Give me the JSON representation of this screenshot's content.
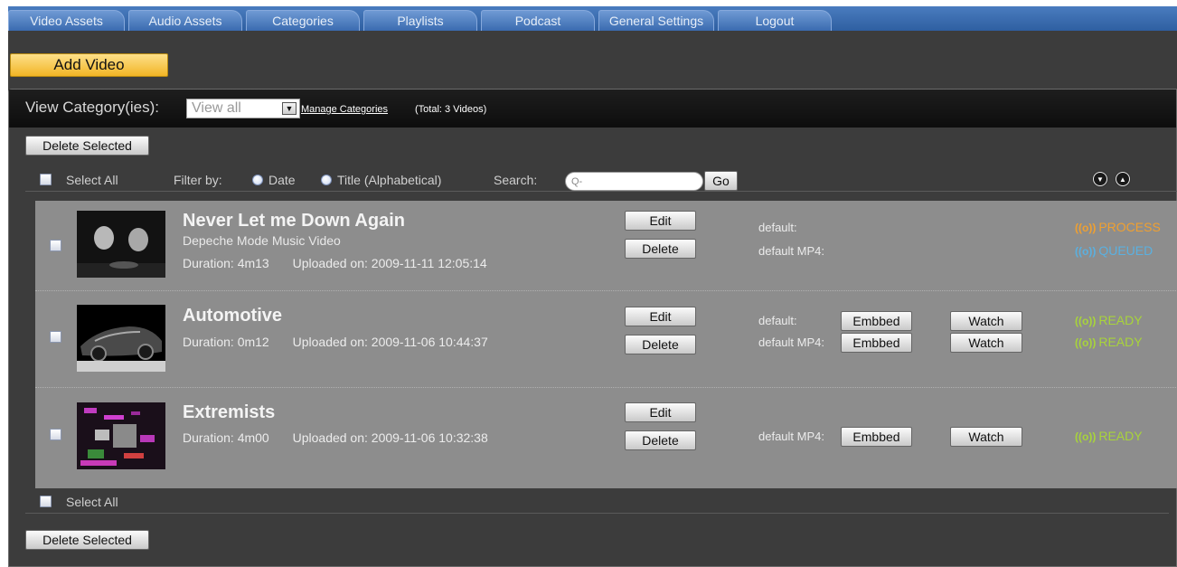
{
  "tabs": [
    "Video Assets",
    "Audio Assets",
    "Categories",
    "Playlists",
    "Podcast",
    "General Settings",
    "Logout"
  ],
  "add_video_label": "Add Video",
  "panel": {
    "view_category_label": "View Category(ies):",
    "category_select_value": "View all",
    "manage_categories_link": "Manage Categories",
    "total_text": "(Total: 3 Videos)",
    "delete_selected_label": "Delete Selected",
    "select_all_label": "Select All",
    "filter_by_label": "Filter by:",
    "filter_date_label": "Date",
    "filter_title_label": "Title (Alphabetical)",
    "search_label": "Search:",
    "search_placeholder": "Q-",
    "go_label": "Go"
  },
  "videos": [
    {
      "title": "Never Let me Down Again",
      "subtitle": "Depeche Mode Music Video",
      "duration": "Duration: 4m13",
      "uploaded": "Uploaded on: 2009-11-11 12:05:14",
      "edit_label": "Edit",
      "delete_label": "Delete",
      "formats": [
        {
          "name": "default:",
          "status": "PROCESS",
          "status_color": "#f0a030"
        },
        {
          "name": "default MP4:",
          "status": "QUEUED",
          "status_color": "#5ab0e0"
        }
      ]
    },
    {
      "title": "Automotive",
      "duration": "Duration: 0m12",
      "uploaded": "Uploaded on: 2009-11-06 10:44:37",
      "edit_label": "Edit",
      "delete_label": "Delete",
      "formats": [
        {
          "name": "default:",
          "embed_label": "Embbed",
          "watch_label": "Watch",
          "status": "READY",
          "status_color": "#a8d43a"
        },
        {
          "name": "default MP4:",
          "embed_label": "Embbed",
          "watch_label": "Watch",
          "status": "READY",
          "status_color": "#a8d43a"
        }
      ]
    },
    {
      "title": "Extremists",
      "duration": "Duration: 4m00",
      "uploaded": "Uploaded on: 2009-11-06 10:32:38",
      "edit_label": "Edit",
      "delete_label": "Delete",
      "formats": [
        {
          "name": "default MP4:",
          "embed_label": "Embbed",
          "watch_label": "Watch",
          "status": "READY",
          "status_color": "#a8d43a"
        }
      ]
    }
  ]
}
